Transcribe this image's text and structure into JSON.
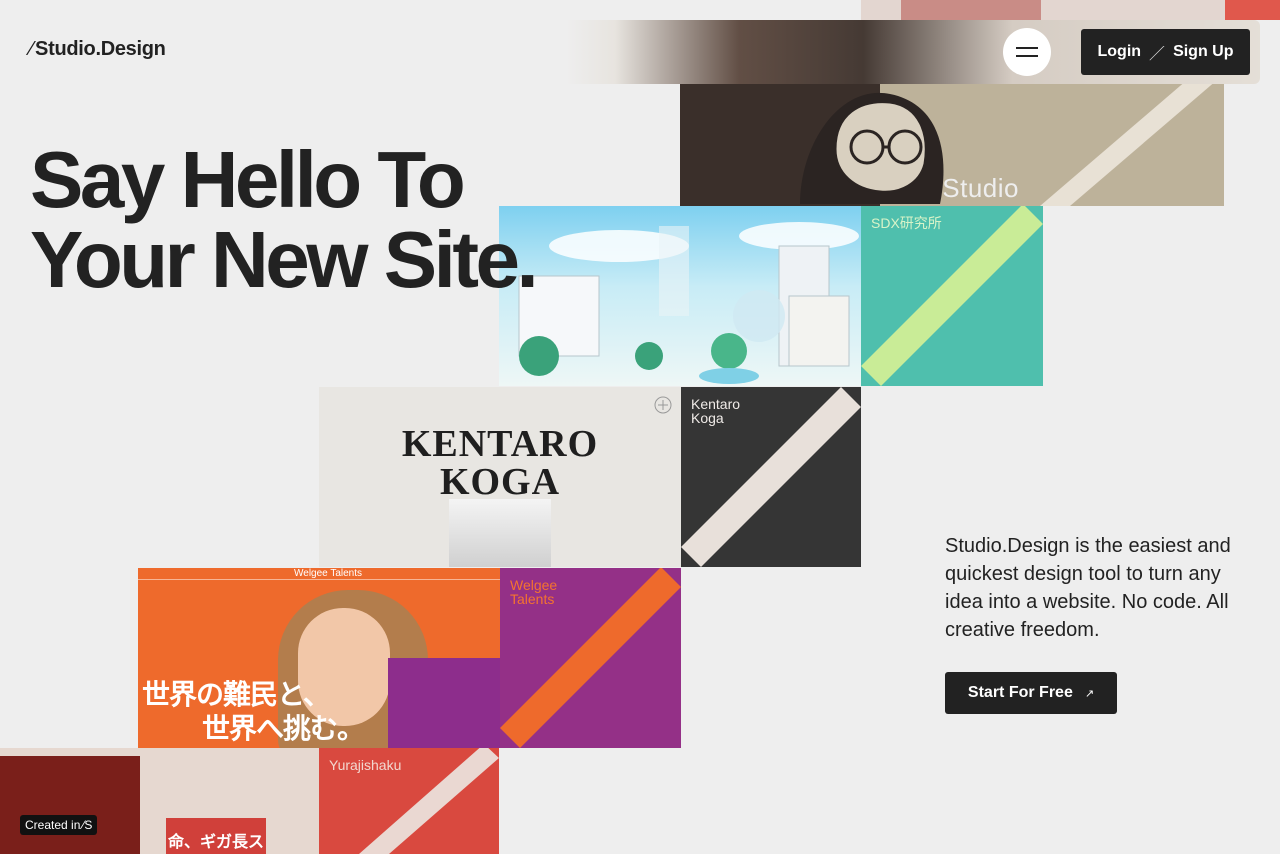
{
  "header": {
    "logo_text": "Studio.Design",
    "logo_mark": "⁄",
    "menu_icon": "hamburger-icon",
    "login_label": "Login",
    "auth_separator": "／",
    "signup_label": "Sign Up"
  },
  "hero": {
    "title_line1": "Say Hello To",
    "title_line2": "Your New Site.",
    "description": "Studio.Design is the easiest and quickest design tool to turn any idea into a website. No code. All creative freedom.",
    "cta_label": "Start For Free",
    "cta_icon": "arrow-up-right-icon",
    "cta_arrow": "↗"
  },
  "showcase": {
    "studio": {
      "image_text": "Studio",
      "colors": {
        "bg": "#bdb29a",
        "stripe": "#ece6dc"
      }
    },
    "sdx": {
      "card_name": "SDX研究所",
      "colors": {
        "bg": "#4fbfad",
        "stripe": "#c9ec97"
      }
    },
    "kentaro": {
      "card_name_line1": "Kentaro",
      "card_name_line2": "Koga",
      "image_line1": "KENTARO",
      "image_line2": "KOGA",
      "colors": {
        "bg": "#353535",
        "stripe": "#e8e0da"
      }
    },
    "welgee": {
      "card_name_line1": "Welgee",
      "card_name_line2": "Talents",
      "image_header": "Welgee Talents",
      "image_jp_line1": "世界の難民と、",
      "image_jp_line2": "世界へ挑む。",
      "colors": {
        "bg": "#943087",
        "stripe": "#ee6a2c"
      }
    },
    "yurajishaku": {
      "card_name": "Yurajishaku",
      "image_jp": "命、ギガ長ス",
      "colors": {
        "bg": "#d9493f",
        "stripe": "#ead8d2"
      }
    }
  },
  "badge": {
    "label": "Created in",
    "mark": "⁄S"
  }
}
